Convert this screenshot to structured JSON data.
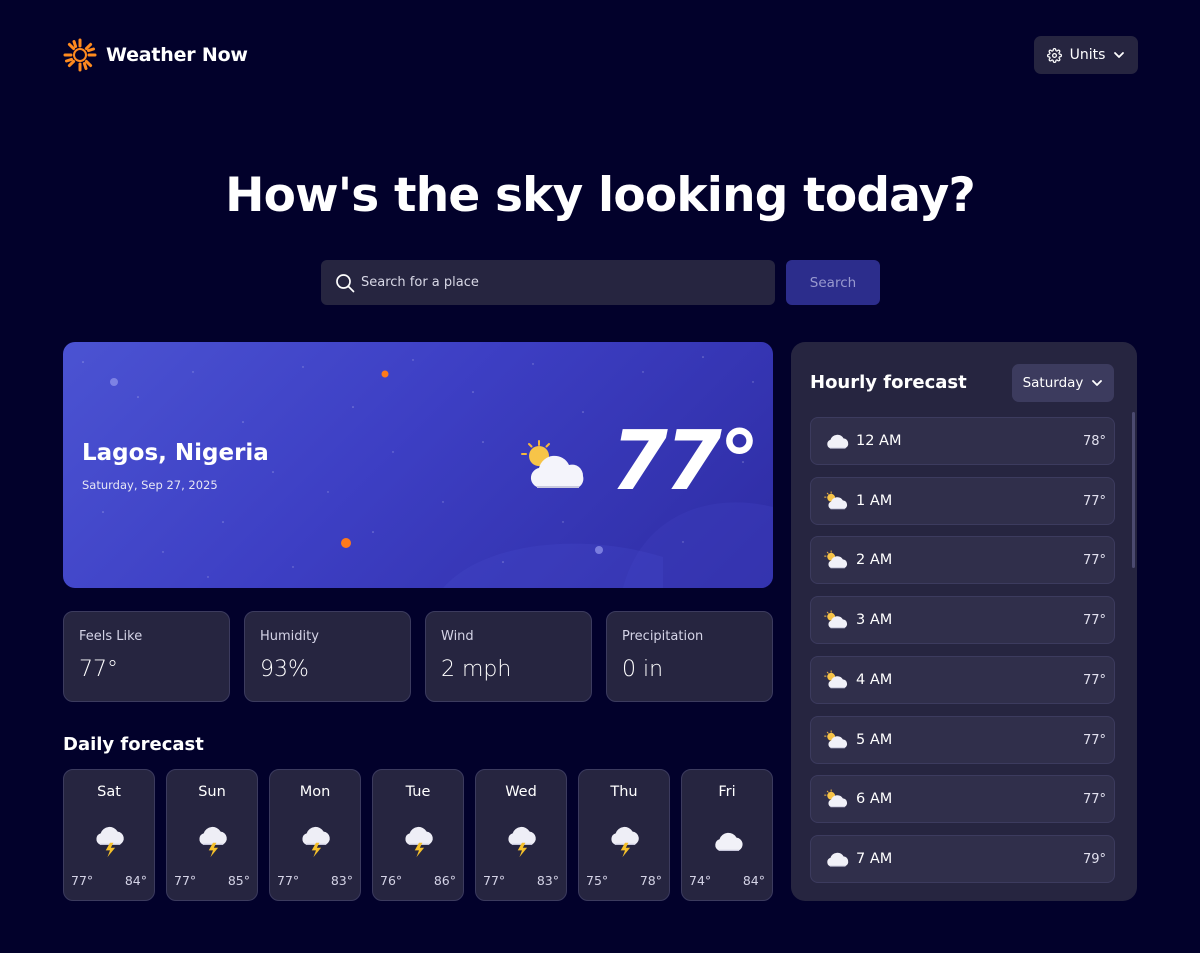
{
  "app": {
    "name": "Weather Now",
    "units_label": "Units"
  },
  "hero": {
    "headline": "How's the sky looking today?"
  },
  "search": {
    "placeholder": "Search for a place",
    "button": "Search"
  },
  "current": {
    "city": "Lagos, Nigeria",
    "date": "Saturday, Sep 27, 2025",
    "temperature": "77°",
    "icon": "partly-cloudy-icon"
  },
  "stats": [
    {
      "label": "Feels Like",
      "value": "77°"
    },
    {
      "label": "Humidity",
      "value": "93%"
    },
    {
      "label": "Wind",
      "value": "2 mph"
    },
    {
      "label": "Precipitation",
      "value": "0 in"
    }
  ],
  "daily": {
    "title": "Daily forecast",
    "days": [
      {
        "day": "Sat",
        "icon": "storm-icon",
        "low": "77°",
        "high": "84°"
      },
      {
        "day": "Sun",
        "icon": "storm-icon",
        "low": "77°",
        "high": "85°"
      },
      {
        "day": "Mon",
        "icon": "storm-icon",
        "low": "77°",
        "high": "83°"
      },
      {
        "day": "Tue",
        "icon": "storm-icon",
        "low": "76°",
        "high": "86°"
      },
      {
        "day": "Wed",
        "icon": "storm-icon",
        "low": "77°",
        "high": "83°"
      },
      {
        "day": "Thu",
        "icon": "storm-icon",
        "low": "75°",
        "high": "78°"
      },
      {
        "day": "Fri",
        "icon": "cloud-icon",
        "low": "74°",
        "high": "84°"
      }
    ]
  },
  "hourly": {
    "title": "Hourly forecast",
    "selected_day": "Saturday",
    "hours": [
      {
        "time": "12 AM",
        "icon": "cloud-icon",
        "temp": "78°"
      },
      {
        "time": "1 AM",
        "icon": "partly-cloudy-icon",
        "temp": "77°"
      },
      {
        "time": "2 AM",
        "icon": "partly-cloudy-icon",
        "temp": "77°"
      },
      {
        "time": "3 AM",
        "icon": "partly-cloudy-icon",
        "temp": "77°"
      },
      {
        "time": "4 AM",
        "icon": "partly-cloudy-icon",
        "temp": "77°"
      },
      {
        "time": "5 AM",
        "icon": "partly-cloudy-icon",
        "temp": "77°"
      },
      {
        "time": "6 AM",
        "icon": "partly-cloudy-icon",
        "temp": "77°"
      },
      {
        "time": "7 AM",
        "icon": "cloud-icon",
        "temp": "79°"
      }
    ]
  },
  "colors": {
    "background": "#02012b",
    "card": "#262540",
    "accent": "#4b53d2",
    "sun": "#ff8a1e"
  }
}
